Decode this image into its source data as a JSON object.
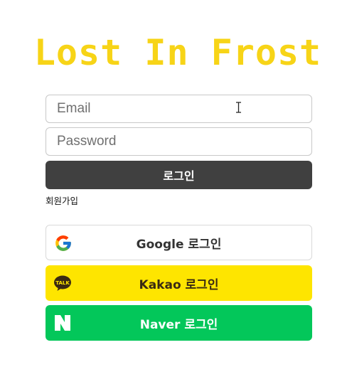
{
  "app": {
    "logo": "Lost In Frost"
  },
  "login_form": {
    "email_placeholder": "Email",
    "email_value": "",
    "password_placeholder": "Password",
    "password_value": "",
    "login_button": "로그인",
    "signup_link": "회원가입"
  },
  "social_login": [
    {
      "provider": "google",
      "label": "Google 로그인",
      "icon": "google-icon"
    },
    {
      "provider": "kakao",
      "label": "Kakao 로그인",
      "icon": "kakao-talk-icon"
    },
    {
      "provider": "naver",
      "label": "Naver 로그인",
      "icon": "naver-icon"
    }
  ],
  "colors": {
    "logo": "#f7d417",
    "login_button": "#404040",
    "kakao": "#fee500",
    "naver": "#03c75a",
    "google_border": "#d9d9d9"
  }
}
